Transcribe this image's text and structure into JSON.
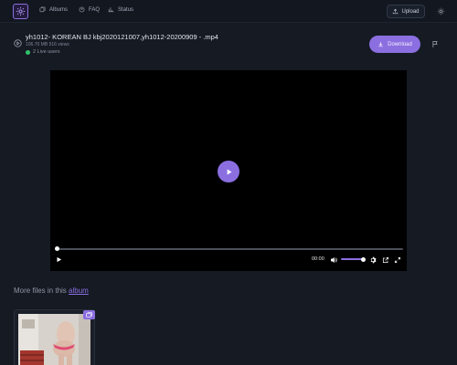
{
  "header": {
    "nav": [
      {
        "label": "Albums",
        "icon": "albums-icon"
      },
      {
        "label": "FAQ",
        "icon": "help-icon"
      },
      {
        "label": "Status",
        "icon": "status-chart-icon"
      }
    ],
    "upload_label": "Upload",
    "theme_icon": "sun-icon"
  },
  "file": {
    "title": "yh1012- KOREAN BJ kbj2020121007,yh1012-20200909 - .mp4",
    "meta": "106.70 MB 516 views",
    "live_users": "2 Live users",
    "download_label": "Download"
  },
  "player": {
    "time": "00:00",
    "progress": 0,
    "volume": 1.0
  },
  "more_files": {
    "prefix": "More files in this",
    "link": "album"
  },
  "colors": {
    "accent": "#8b6fe0",
    "background": "#151a23",
    "live": "#31c26a"
  }
}
